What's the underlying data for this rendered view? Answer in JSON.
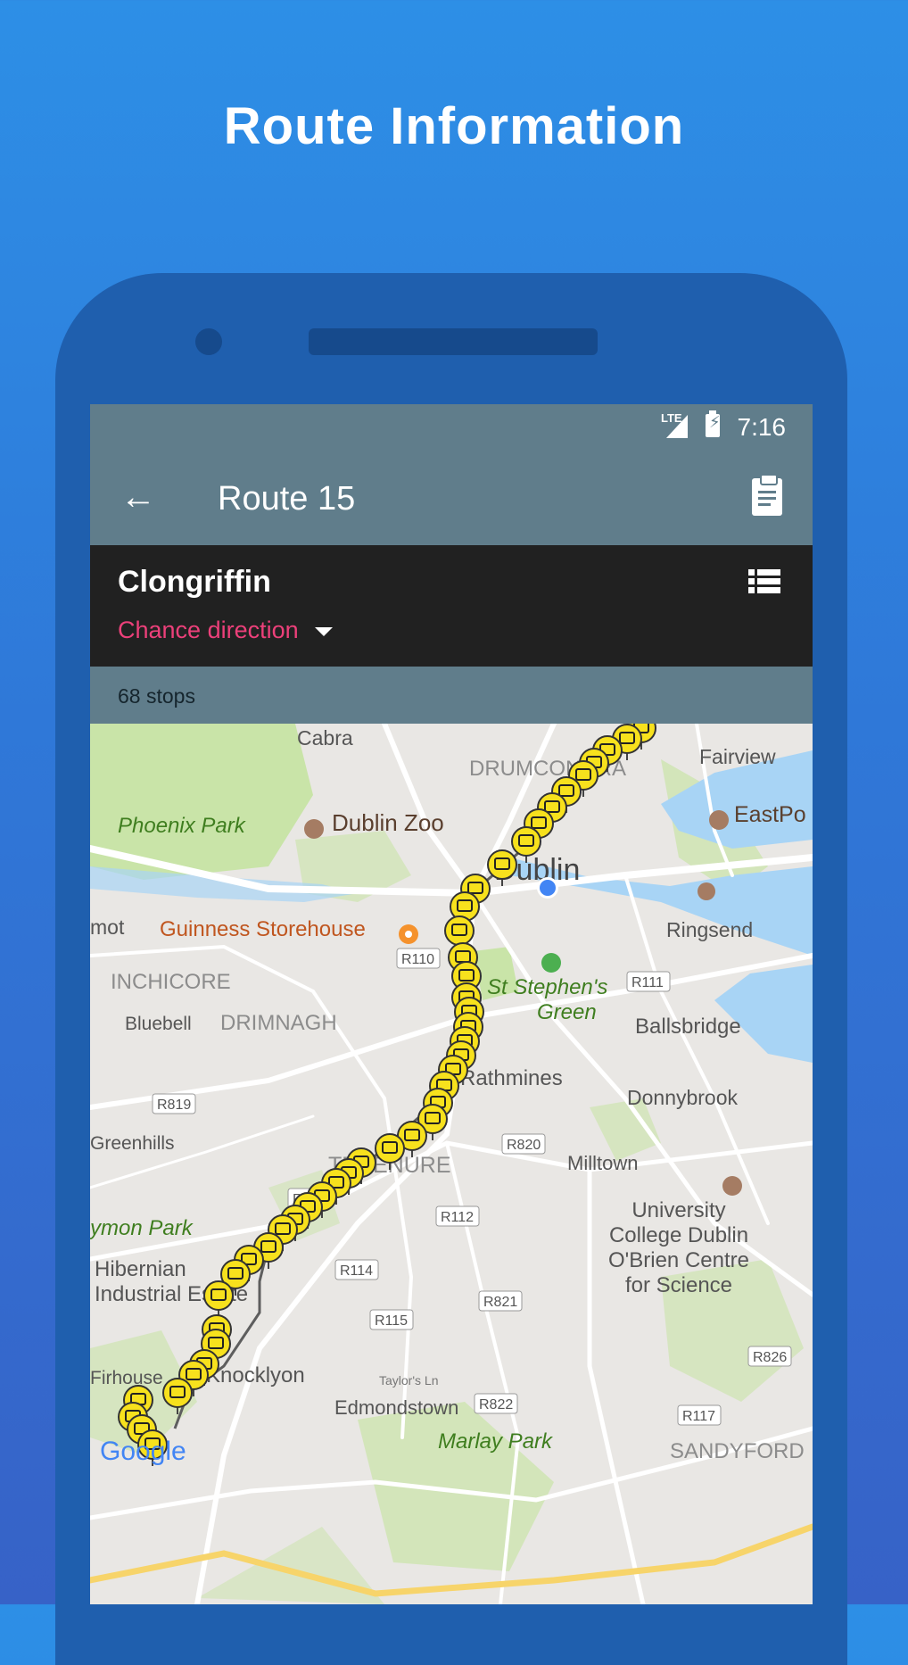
{
  "promo": {
    "title": "Route Information"
  },
  "status_bar": {
    "network": "LTE",
    "time": "7:16"
  },
  "app_bar": {
    "back_icon": "arrow-back-icon",
    "title": "Route 15",
    "action_icon": "clipboard-icon"
  },
  "direction_header": {
    "destination": "Clongriffin",
    "change_direction_label": "Chance direction",
    "list_icon": "list-view-icon"
  },
  "stops_summary": {
    "label": "68 stops"
  },
  "map": {
    "attribution": "Google",
    "place_labels": {
      "cabra": "Cabra",
      "drumcondra": "DRUMCONDRA",
      "fairview": "Fairview",
      "phoenix_park": "Phoenix Park",
      "dublin_zoo": "Dublin Zoo",
      "eastpoint": "EastPo",
      "dublin": "Dublin",
      "kilmainham": "mot",
      "guinness": "Guinness Storehouse",
      "ringsend": "Ringsend",
      "r110": "R110",
      "inchicore": "INCHICORE",
      "st_stephens_1": "St Stephen's",
      "st_stephens_2": "Green",
      "r111": "R111",
      "bluebell": "Bluebell",
      "drimnagh": "DRIMNAGH",
      "ballsbridge": "Ballsbridge",
      "rathmines": "Rathmines",
      "r819": "R819",
      "donnybrook": "Donnybrook",
      "greenhills": "Greenhills",
      "r820": "R820",
      "terenure": "TERENURE",
      "milltown": "Milltown",
      "r817": "R817",
      "r112": "R112",
      "ucd_1": "University",
      "ucd_2": "College Dublin",
      "ucd_3": "O'Brien Centre",
      "ucd_4": "for Science",
      "tymon_park": "ymon Park",
      "hibernian_1": "Hibernian",
      "hibernian_2": "Industrial Estate",
      "r114": "R114",
      "r821": "R821",
      "r115": "R115",
      "r826": "R826",
      "firhouse": "Firhouse",
      "knocklyon": "Knocklyon",
      "taylors_ln": "Taylor's Ln",
      "r822": "R822",
      "edmondstown": "Edmondstown",
      "r117": "R117",
      "marlay_park": "Marlay Park",
      "sandyford": "SANDYFORD"
    },
    "colors": {
      "land": "#e9e7e4",
      "park": "#c9e4a8",
      "water": "#a8d4f5",
      "stop_marker": "#f7e11d",
      "current_location": "#4285f4",
      "poi_orange": "#f5922c"
    },
    "stop_marker_icon": "bus-stop-icon",
    "location_icon": "current-location-dot-icon"
  }
}
